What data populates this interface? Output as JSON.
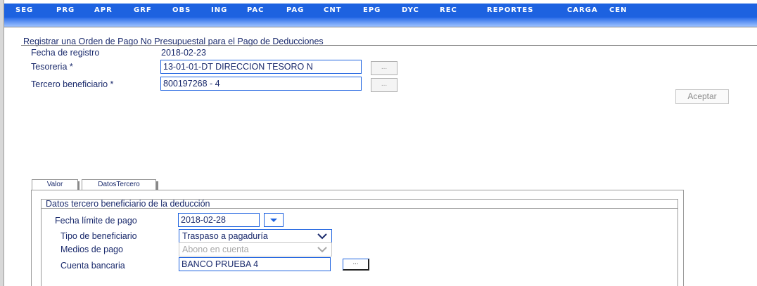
{
  "menu": {
    "items": [
      "SEG",
      "PRG",
      "APR",
      "GRF",
      "OBS",
      "ING",
      "PAC",
      "PAG",
      "CNT",
      "EPG",
      "DYC",
      "REC",
      "REPORTES",
      "CARGA",
      "CEN"
    ]
  },
  "form": {
    "title": "Registrar una Orden de Pago No Presupuestal para el Pago de Deducciones",
    "fecha_registro_label": "Fecha de registro",
    "fecha_registro_value": "2018-02-23",
    "tesoreria_label": "Tesoreria *",
    "tesoreria_value": "13-01-01-DT DIRECCION TESORO N",
    "tercero_label": "Tercero beneficiario *",
    "tercero_value": "800197268 - 4",
    "lookup_button": "...",
    "accept_button": "Aceptar"
  },
  "tabs": [
    {
      "label": "Valor",
      "active": false
    },
    {
      "label": "DatosTercero",
      "active": true
    }
  ],
  "datos_tercero": {
    "group_title": "Datos tercero beneficiario de la deducción",
    "fecha_limite_label": "Fecha límite de pago",
    "fecha_limite_value": "2018-02-28",
    "tipo_beneficiario_label": "Tipo de beneficiario",
    "tipo_beneficiario_value": "Traspaso a pagaduría",
    "medios_pago_label": "Medios de pago",
    "medios_pago_value": "Abono en cuenta",
    "cuenta_bancaria_label": "Cuenta bancaria",
    "cuenta_bancaria_value": "BANCO PRUEBA 4",
    "lookup_button": "..."
  },
  "colors": {
    "menu_bar": "#1d62e0",
    "text": "#1a2a6c",
    "field_border": "#1d62e0"
  },
  "icons": {
    "date_dropdown": "triangle-down-icon",
    "select_chevron": "chevron-down-icon"
  }
}
